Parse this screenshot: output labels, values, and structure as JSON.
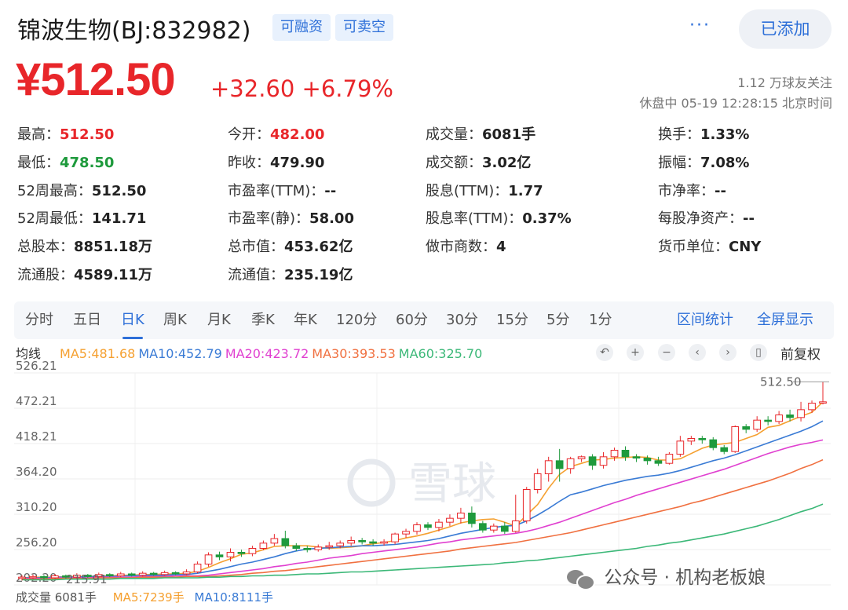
{
  "header": {
    "title": "锦波生物(BJ:832982)",
    "tags": [
      "可融资",
      "可卖空"
    ],
    "more_label": "···",
    "added_label": "已添加"
  },
  "quote": {
    "price": "¥512.50",
    "change": "+32.60 +6.79%",
    "followers": "1.12 万球友关注",
    "status": "休盘中 05-19 12:28:15 北京时间"
  },
  "stats": [
    [
      {
        "label": "最高：",
        "value": "512.50",
        "tone": "red"
      },
      {
        "label": "今开：",
        "value": "482.00",
        "tone": "red"
      },
      {
        "label": "成交量：",
        "value": "6081手",
        "tone": ""
      },
      {
        "label": "换手：",
        "value": "1.33%",
        "tone": ""
      }
    ],
    [
      {
        "label": "最低：",
        "value": "478.50",
        "tone": "green"
      },
      {
        "label": "昨收：",
        "value": "479.90",
        "tone": ""
      },
      {
        "label": "成交额：",
        "value": "3.02亿",
        "tone": ""
      },
      {
        "label": "振幅：",
        "value": "7.08%",
        "tone": ""
      }
    ],
    [
      {
        "label": "52周最高：",
        "value": "512.50",
        "tone": ""
      },
      {
        "label": "市盈率(TTM)：",
        "value": "--",
        "tone": ""
      },
      {
        "label": "股息(TTM)：",
        "value": "1.77",
        "tone": ""
      },
      {
        "label": "市净率：",
        "value": "--",
        "tone": ""
      }
    ],
    [
      {
        "label": "52周最低：",
        "value": "141.71",
        "tone": ""
      },
      {
        "label": "市盈率(静)：",
        "value": "58.00",
        "tone": ""
      },
      {
        "label": "股息率(TTM)：",
        "value": "0.37%",
        "tone": ""
      },
      {
        "label": "每股净资产：",
        "value": "--",
        "tone": ""
      }
    ],
    [
      {
        "label": "总股本：",
        "value": "8851.18万",
        "tone": ""
      },
      {
        "label": "总市值：",
        "value": "453.62亿",
        "tone": ""
      },
      {
        "label": "做市商数：",
        "value": "4",
        "tone": ""
      },
      {
        "label": "货币单位：",
        "value": "CNY",
        "tone": ""
      }
    ],
    [
      {
        "label": "流通股：",
        "value": "4589.11万",
        "tone": ""
      },
      {
        "label": "流通值：",
        "value": "235.19亿",
        "tone": ""
      }
    ]
  ],
  "period_tabs": [
    "分时",
    "五日",
    "日K",
    "周K",
    "月K",
    "季K",
    "年K",
    "120分",
    "60分",
    "30分",
    "15分",
    "5分",
    "1分"
  ],
  "active_tab": "日K",
  "period_links": [
    "区间统计",
    "全屏显示"
  ],
  "ma_bar": {
    "title": "均线",
    "items": [
      {
        "text": "MA5:481.68",
        "color": "#f5a030"
      },
      {
        "text": "MA10:452.79",
        "color": "#3a7bd5"
      },
      {
        "text": "MA20:423.72",
        "color": "#e040d0"
      },
      {
        "text": "MA30:393.53",
        "color": "#f07040"
      },
      {
        "text": "MA60:325.70",
        "color": "#3cb878"
      }
    ],
    "controls": [
      "↶",
      "+",
      "−",
      "‹",
      "›",
      "▯"
    ],
    "adjust_label": "前复权"
  },
  "chart_data": {
    "type": "candlestick",
    "y_ticks": [
      "526.21",
      "472.21",
      "418.21",
      "364.20",
      "310.20",
      "256.20",
      "202.20"
    ],
    "ylim": [
      202.2,
      526.21
    ],
    "last_label": "512.50",
    "bottom_label": "215.91",
    "up_color": "#e8262a",
    "down_color": "#1e9a3c",
    "candles": [
      [
        212,
        214,
        209,
        217
      ],
      [
        214,
        215,
        211,
        218
      ],
      [
        215,
        213,
        210,
        217
      ],
      [
        213,
        216,
        211,
        219
      ],
      [
        216,
        214,
        212,
        218
      ],
      [
        214,
        217,
        212,
        220
      ],
      [
        217,
        215,
        213,
        219
      ],
      [
        215,
        218,
        213,
        221
      ],
      [
        218,
        216,
        214,
        220
      ],
      [
        216,
        219,
        214,
        222
      ],
      [
        219,
        217,
        215,
        221
      ],
      [
        217,
        220,
        215,
        223
      ],
      [
        220,
        218,
        216,
        222
      ],
      [
        218,
        221,
        216,
        224
      ],
      [
        221,
        219,
        217,
        223
      ],
      [
        219,
        222,
        217,
        226
      ],
      [
        222,
        234,
        220,
        238
      ],
      [
        234,
        248,
        230,
        252
      ],
      [
        248,
        245,
        240,
        253
      ],
      [
        245,
        252,
        238,
        258
      ],
      [
        252,
        250,
        245,
        256
      ],
      [
        250,
        258,
        246,
        262
      ],
      [
        258,
        266,
        255,
        270
      ],
      [
        266,
        273,
        262,
        280
      ],
      [
        273,
        262,
        258,
        285
      ],
      [
        262,
        258,
        254,
        266
      ],
      [
        258,
        256,
        252,
        262
      ],
      [
        256,
        260,
        253,
        264
      ],
      [
        260,
        262,
        256,
        268
      ],
      [
        262,
        266,
        258,
        270
      ],
      [
        266,
        270,
        262,
        276
      ],
      [
        270,
        268,
        264,
        274
      ],
      [
        268,
        266,
        262,
        272
      ],
      [
        266,
        268,
        262,
        272
      ],
      [
        268,
        280,
        264,
        282
      ],
      [
        280,
        284,
        274,
        288
      ],
      [
        284,
        294,
        279,
        298
      ],
      [
        294,
        290,
        286,
        298
      ],
      [
        290,
        298,
        284,
        303
      ],
      [
        298,
        304,
        292,
        310
      ],
      [
        304,
        312,
        296,
        320
      ],
      [
        312,
        296,
        290,
        322
      ],
      [
        296,
        286,
        282,
        300
      ],
      [
        286,
        292,
        282,
        296
      ],
      [
        292,
        284,
        280,
        298
      ],
      [
        284,
        300,
        282,
        340
      ],
      [
        300,
        348,
        296,
        352
      ],
      [
        348,
        372,
        342,
        380
      ],
      [
        372,
        392,
        360,
        398
      ],
      [
        392,
        380,
        360,
        410
      ],
      [
        380,
        395,
        372,
        398
      ],
      [
        395,
        398,
        390,
        400
      ],
      [
        398,
        385,
        378,
        402
      ],
      [
        385,
        398,
        380,
        405
      ],
      [
        398,
        408,
        392,
        412
      ],
      [
        408,
        398,
        392,
        414
      ],
      [
        398,
        396,
        390,
        402
      ],
      [
        396,
        392,
        386,
        400
      ],
      [
        392,
        388,
        384,
        398
      ],
      [
        388,
        402,
        386,
        405
      ],
      [
        402,
        422,
        398,
        430
      ],
      [
        422,
        426,
        416,
        430
      ],
      [
        426,
        424,
        418,
        430
      ],
      [
        424,
        412,
        408,
        428
      ],
      [
        412,
        406,
        402,
        416
      ],
      [
        406,
        444,
        404,
        446
      ],
      [
        444,
        440,
        434,
        448
      ],
      [
        440,
        454,
        436,
        460
      ],
      [
        454,
        452,
        446,
        460
      ],
      [
        452,
        462,
        448,
        468
      ],
      [
        462,
        458,
        452,
        470
      ],
      [
        458,
        470,
        452,
        482
      ],
      [
        470,
        480,
        465,
        484
      ],
      [
        480,
        482,
        478,
        512.5
      ]
    ],
    "ma_series": [
      {
        "name": "MA5",
        "color": "#f5a030",
        "values": [
          213,
          214,
          214,
          214,
          215,
          215,
          215,
          216,
          216,
          217,
          217,
          218,
          218,
          219,
          219,
          220,
          223,
          229,
          236,
          242,
          249,
          251,
          256,
          261,
          262,
          262,
          262,
          260,
          258,
          259,
          260,
          262,
          265,
          267,
          270,
          274,
          277,
          281,
          286,
          291,
          297,
          300,
          302,
          303,
          298,
          292,
          309,
          325,
          350,
          371,
          383,
          388,
          393,
          394,
          396,
          397,
          398,
          397,
          393,
          393,
          395,
          403,
          411,
          416,
          418,
          420,
          426,
          432,
          443,
          446,
          453,
          460,
          466,
          481.68
        ]
      },
      {
        "name": "MA10",
        "color": "#3a7bd5",
        "values": [
          213,
          213,
          213,
          214,
          214,
          214,
          215,
          215,
          215,
          216,
          216,
          217,
          217,
          217,
          218,
          218,
          220,
          223,
          226,
          230,
          234,
          237,
          241,
          245,
          250,
          254,
          257,
          258,
          259,
          260,
          261,
          262,
          262,
          263,
          264,
          266,
          268,
          270,
          273,
          277,
          281,
          284,
          287,
          290,
          292,
          293,
          300,
          309,
          319,
          330,
          340,
          344,
          349,
          354,
          358,
          362,
          365,
          368,
          370,
          373,
          377,
          382,
          387,
          392,
          396,
          401,
          407,
          413,
          419,
          425,
          431,
          437,
          444,
          452.79
        ]
      },
      {
        "name": "MA20",
        "color": "#e040d0",
        "values": [
          212,
          212,
          212,
          213,
          213,
          213,
          213,
          214,
          214,
          214,
          214,
          215,
          215,
          215,
          216,
          216,
          216,
          217,
          219,
          221,
          223,
          225,
          227,
          230,
          232,
          235,
          237,
          240,
          243,
          245,
          247,
          250,
          252,
          254,
          256,
          258,
          260,
          263,
          266,
          268,
          271,
          273,
          275,
          277,
          279,
          281,
          284,
          288,
          293,
          298,
          304,
          310,
          316,
          322,
          328,
          333,
          339,
          344,
          349,
          354,
          359,
          364,
          369,
          374,
          379,
          385,
          391,
          397,
          403,
          408,
          413,
          417,
          420,
          423.72
        ]
      },
      {
        "name": "MA30",
        "color": "#f07040",
        "values": [
          211,
          211,
          211,
          212,
          212,
          212,
          212,
          213,
          213,
          213,
          213,
          214,
          214,
          214,
          214,
          215,
          215,
          215,
          216,
          217,
          218,
          220,
          221,
          223,
          224,
          226,
          228,
          230,
          232,
          234,
          236,
          238,
          240,
          242,
          244,
          246,
          248,
          250,
          252,
          254,
          257,
          259,
          261,
          263,
          265,
          267,
          270,
          273,
          276,
          279,
          282,
          286,
          290,
          294,
          298,
          302,
          306,
          310,
          314,
          318,
          322,
          327,
          331,
          336,
          341,
          346,
          351,
          356,
          361,
          367,
          373,
          380,
          386,
          393.53
        ]
      },
      {
        "name": "MA60",
        "color": "#3cb878",
        "values": [
          210,
          210,
          210,
          210,
          211,
          211,
          211,
          211,
          211,
          212,
          212,
          212,
          212,
          213,
          213,
          213,
          213,
          214,
          214,
          215,
          215,
          216,
          216,
          217,
          217,
          218,
          219,
          219,
          220,
          221,
          222,
          222,
          223,
          224,
          225,
          226,
          227,
          228,
          229,
          230,
          231,
          232,
          233,
          234,
          236,
          237,
          239,
          240,
          242,
          244,
          246,
          248,
          250,
          252,
          254,
          256,
          258,
          261,
          263,
          266,
          268,
          271,
          274,
          277,
          280,
          284,
          288,
          292,
          297,
          302,
          308,
          314,
          319,
          325.7
        ]
      }
    ]
  },
  "volume_bar": {
    "label": "成交量 6081手",
    "ma5": "MA5:7239手",
    "ma10": "MA10:8111手",
    "ma5_color": "#f5a030",
    "ma10_color": "#3a7bd5"
  },
  "watermark": {
    "center_text": "雪球",
    "corner_text": "公众号 · 机构老板娘"
  }
}
